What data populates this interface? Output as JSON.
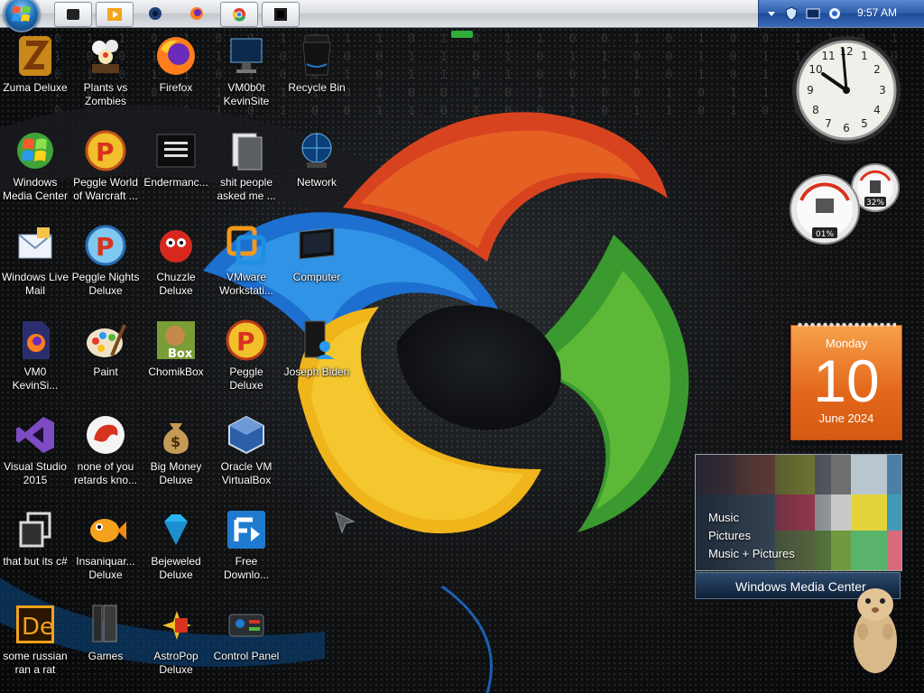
{
  "taskbar": {
    "start": "start-orb",
    "buttons": [
      "app-window-1",
      "media-player",
      "cortana-circle",
      "firefox",
      "chrome",
      "terminal"
    ],
    "clock": "9:57 AM"
  },
  "icons": [
    {
      "label": "Zuma Deluxe",
      "icon": "zuma-icon"
    },
    {
      "label": "Plants vs\nZombies",
      "icon": "plants-vs-zombies-icon"
    },
    {
      "label": "Firefox",
      "icon": "firefox-icon"
    },
    {
      "label": "VM0b0t\nKevinSite",
      "icon": "monitor-icon"
    },
    {
      "label": "Recycle Bin",
      "icon": "recycle-bin-icon"
    },
    {
      "label": "Windows\nMedia Center",
      "icon": "windows-media-center-icon"
    },
    {
      "label": "Peggle World\nof Warcraft ...",
      "icon": "peggle-icon"
    },
    {
      "label": "Endermanc...",
      "icon": "document-window-icon"
    },
    {
      "label": "shit people\nasked me ...",
      "icon": "folder-icon"
    },
    {
      "label": "Network",
      "icon": "network-icon"
    },
    {
      "label": "Windows Live\nMail",
      "icon": "mail-icon"
    },
    {
      "label": "Peggle Nights\nDeluxe",
      "icon": "peggle-nights-icon"
    },
    {
      "label": "Chuzzle\nDeluxe",
      "icon": "chuzzle-icon"
    },
    {
      "label": "VMware\nWorkstati...",
      "icon": "vmware-icon"
    },
    {
      "label": "Computer",
      "icon": "computer-icon"
    },
    {
      "label": "VM0\nKevinSi...",
      "icon": "firefox-file-icon"
    },
    {
      "label": "Paint",
      "icon": "paint-icon"
    },
    {
      "label": "ChomikBox",
      "icon": "chomikbox-icon"
    },
    {
      "label": "Peggle Deluxe",
      "icon": "peggle-deluxe-icon"
    },
    {
      "label": "Joseph Biden",
      "icon": "user-folder-icon"
    },
    {
      "label": "Visual Studio\n2015",
      "icon": "visual-studio-icon"
    },
    {
      "label": "none of you\nretards kno...",
      "icon": "dragon-icon"
    },
    {
      "label": "Big Money\nDeluxe",
      "icon": "money-bag-icon"
    },
    {
      "label": "Oracle VM\nVirtualBox",
      "icon": "virtualbox-icon"
    },
    {
      "label": "that but its c#",
      "icon": "copy-icon"
    },
    {
      "label": "Insaniquar...\nDeluxe",
      "icon": "fish-icon"
    },
    {
      "label": "Bejeweled\nDeluxe",
      "icon": "gem-icon"
    },
    {
      "label": "Free\nDownlo...",
      "icon": "download-icon"
    },
    {
      "label": "some russian\nran a rat",
      "icon": "de-icon"
    },
    {
      "label": "Games",
      "icon": "games-icon"
    },
    {
      "label": "AstroPop\nDeluxe",
      "icon": "astropop-icon"
    },
    {
      "label": "Control Panel",
      "icon": "control-panel-icon"
    }
  ],
  "gadgets": {
    "meter": {
      "cpu": "01%",
      "memory": "32%"
    },
    "calendar": {
      "day": "Monday",
      "date": "10",
      "month": "June 2024"
    },
    "media_center": {
      "menu": [
        "Music",
        "Pictures",
        "Music + Pictures"
      ],
      "title": "Windows Media Center"
    }
  },
  "colors": {
    "calendar": "#e3671b",
    "taskbar": "#d7dadf",
    "tray": "#2b5aa8",
    "swirl_red": "#e0401e",
    "swirl_blue": "#2a8fe0",
    "swirl_green": "#3fa53a",
    "swirl_yellow": "#f2c81d"
  }
}
